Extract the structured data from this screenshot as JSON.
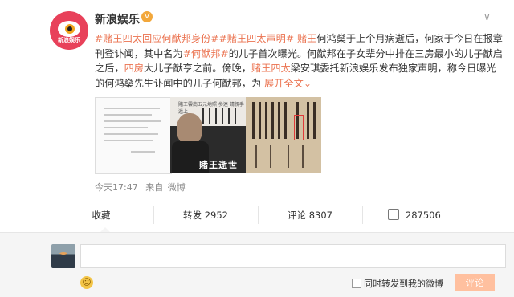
{
  "account": {
    "name": "新浪娱乐",
    "avatar_caption": "新浪娱乐",
    "verified_icon": "verified-v-icon"
  },
  "post": {
    "segments": [
      {
        "text": "#赌王四太回应何猷邦身份#",
        "kind": "tag"
      },
      {
        "text": "#赌王四太声明#",
        "kind": "tag"
      },
      {
        "text": " ",
        "kind": "plain"
      },
      {
        "text": "赌王",
        "kind": "tag"
      },
      {
        "text": "何鸿燊于上个月病逝后，何家于今日在报章刊登讣闻，其中名为",
        "kind": "plain"
      },
      {
        "text": "#何猷邦#",
        "kind": "tag"
      },
      {
        "text": "的儿子首次曝光。何猷邦在子女辈分中排在三房最小的儿子猷启之后，",
        "kind": "plain"
      },
      {
        "text": "四房",
        "kind": "tag"
      },
      {
        "text": "大儿子猷亨之前。傍晚，",
        "kind": "plain"
      },
      {
        "text": "赌王四太",
        "kind": "tag"
      },
      {
        "text": "梁安琪委托新浪娱乐发布独家声明，称今日曝光的何鸿燊先生讣闻中的儿子何猷邦，为",
        "kind": "plain"
      },
      {
        "text": " 展开全文",
        "kind": "link"
      },
      {
        "text": "⌄",
        "kind": "link"
      }
    ],
    "image2_caption": "賭王逝世",
    "image2_header": "賭王雲南五元地照 歩連 請親手遞上"
  },
  "meta": {
    "time": "今天17:47",
    "source_prefix": "来自",
    "source": "微博"
  },
  "actions": [
    {
      "label": "收藏",
      "count": ""
    },
    {
      "label": "转发",
      "count": "2952"
    },
    {
      "label": "评论",
      "count": "8307"
    },
    {
      "label": "",
      "count": "287506",
      "icon": "thumbs-up-icon"
    }
  ],
  "composer": {
    "placeholder": "",
    "emoji_icon": "smiley-icon",
    "checkbox_label": "同时转发到我的微博",
    "submit_label": "评论"
  },
  "colors": {
    "accent": "#eb7350",
    "submit_bg": "#ffc09f"
  }
}
